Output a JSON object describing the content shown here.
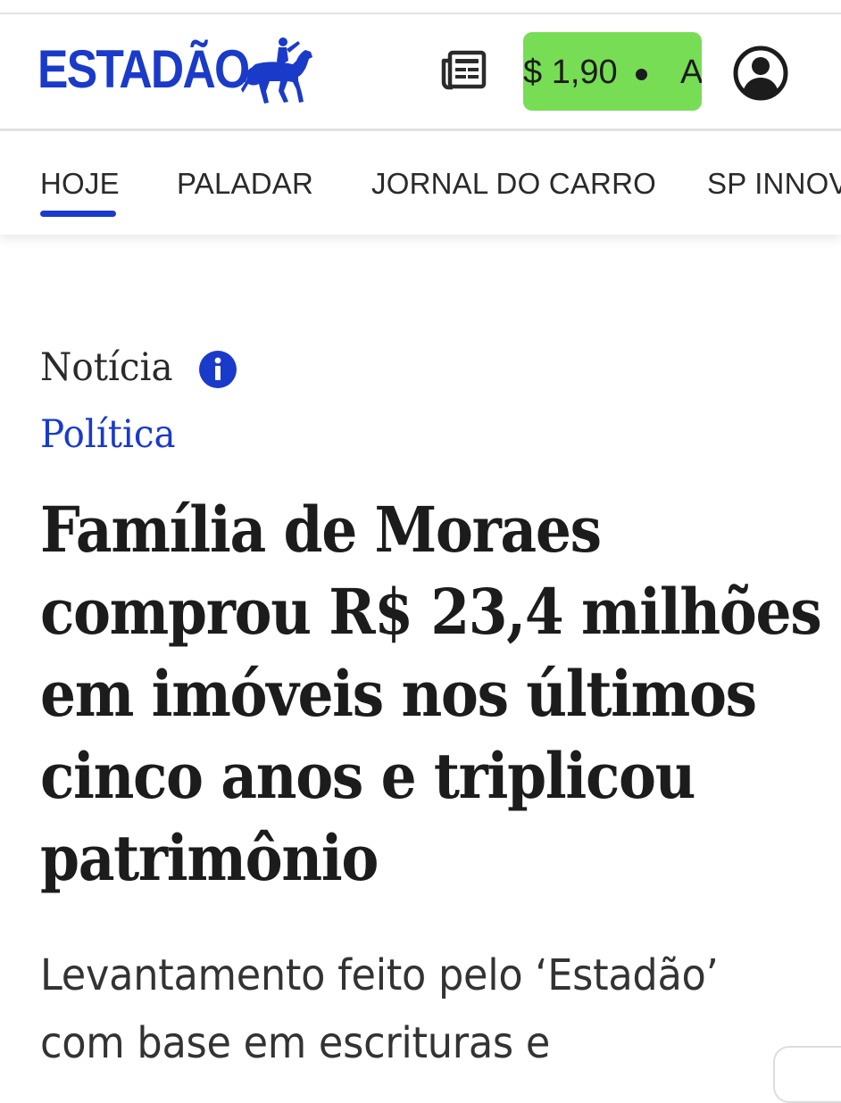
{
  "header": {
    "logo_text": "ESTADÃO",
    "logo_icon": "horse-rider-icon",
    "edition_icon": "newspaper-icon",
    "price_label": "$ 1,90",
    "price_cta": "A",
    "account_icon": "user-icon",
    "brand_color": "#1a3bc9",
    "price_button_color": "#77dd55"
  },
  "nav": {
    "items": [
      {
        "label": "HOJE",
        "active": true
      },
      {
        "label": "PALADAR"
      },
      {
        "label": "JORNAL DO CARRO"
      },
      {
        "label": "SP INNOV"
      }
    ]
  },
  "article": {
    "kicker": "Notícia",
    "kicker_icon": "info-icon",
    "section": "Política",
    "headline_lines": [
      "Família de Moraes",
      "comprou R$ 23,4 milhões",
      "em imóveis nos últimos",
      "cinco anos e triplicou",
      "patrimônio"
    ],
    "subhead_lines": [
      "Levantamento feito pelo ‘Estadão’",
      "com base em escrituras e"
    ]
  }
}
